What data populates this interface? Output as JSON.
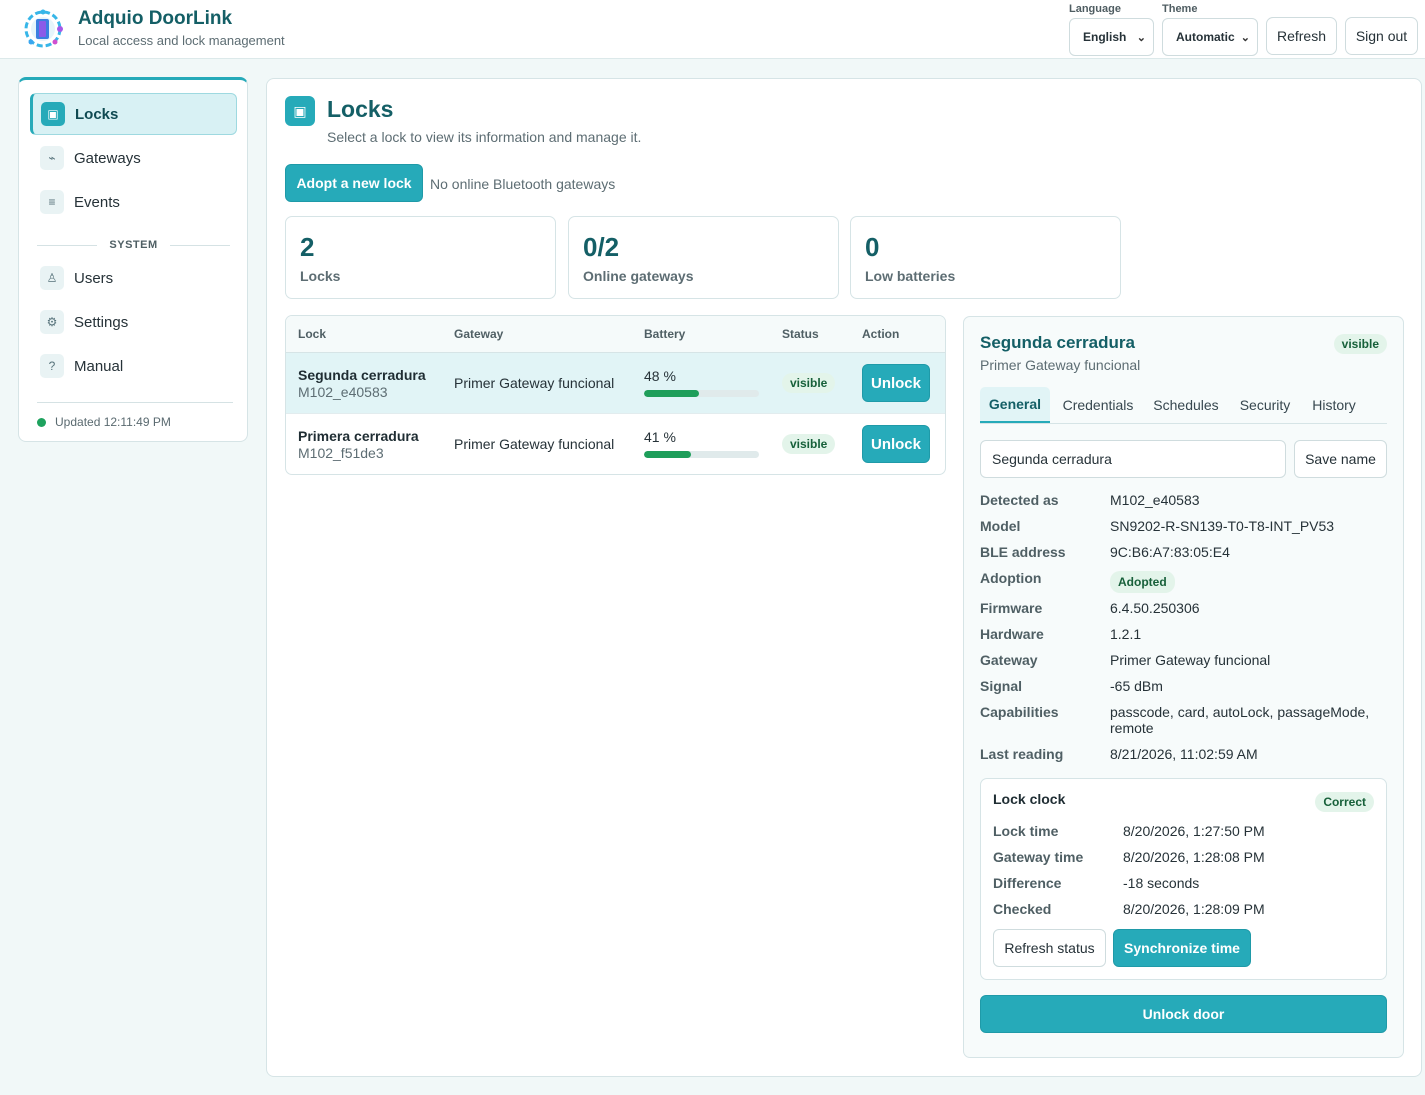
{
  "header": {
    "title": "Adquio DoorLink",
    "subtitle": "Local access and lock management",
    "language_label": "Language",
    "language_value": "English",
    "theme_label": "Theme",
    "theme_value": "Automatic",
    "refresh_label": "Refresh",
    "signout_label": "Sign out"
  },
  "sidebar": {
    "items": [
      {
        "label": "Locks",
        "icon": "lock-icon",
        "glyph": "▣",
        "active": true
      },
      {
        "label": "Gateways",
        "icon": "gateway-icon",
        "glyph": "⌁"
      },
      {
        "label": "Events",
        "icon": "events-icon",
        "glyph": "≡"
      },
      {
        "label": "Users",
        "icon": "users-icon",
        "glyph": "♙"
      },
      {
        "label": "Settings",
        "icon": "gear-icon",
        "glyph": "⚙"
      },
      {
        "label": "Manual",
        "icon": "help-icon",
        "glyph": "?"
      }
    ],
    "system_label": "SYSTEM",
    "updated_text": "Updated 12:11:49 PM"
  },
  "main": {
    "icon_glyph": "▣",
    "title": "Locks",
    "subtitle": "Select a lock to view its information and manage it.",
    "adopt_label": "Adopt a new lock",
    "no_gateways_text": "No online Bluetooth gateways",
    "stats": [
      {
        "value": "2",
        "label": "Locks"
      },
      {
        "value": "0/2",
        "label": "Online gateways"
      },
      {
        "value": "0",
        "label": "Low batteries"
      }
    ]
  },
  "table": {
    "columns": [
      "Lock",
      "Gateway",
      "Battery",
      "Status",
      "Action"
    ],
    "rows": [
      {
        "name": "Segunda cerradura",
        "id": "M102_e40583",
        "gateway": "Primer Gateway funcional",
        "battery": "48 %",
        "battery_pct": 48,
        "status": "visible",
        "action": "Unlock",
        "selected": true
      },
      {
        "name": "Primera cerradura",
        "id": "M102_f51de3",
        "gateway": "Primer Gateway funcional",
        "battery": "41 %",
        "battery_pct": 41,
        "status": "visible",
        "action": "Unlock",
        "selected": false
      }
    ]
  },
  "detail": {
    "title": "Segunda cerradura",
    "subtitle": "Primer Gateway funcional",
    "badge": "visible",
    "tabs": [
      "General",
      "Credentials",
      "Schedules",
      "Security",
      "History"
    ],
    "name_value": "Segunda cerradura",
    "save_name_label": "Save name",
    "info": [
      {
        "key": "Detected as",
        "value": "M102_e40583"
      },
      {
        "key": "Model",
        "value": "SN9202-R-SN139-T0-T8-INT_PV53"
      },
      {
        "key": "BLE address",
        "value": "9C:B6:A7:83:05:E4"
      },
      {
        "key": "Adoption",
        "value": "Adopted"
      },
      {
        "key": "Firmware",
        "value": "6.4.50.250306"
      },
      {
        "key": "Hardware",
        "value": "1.2.1"
      },
      {
        "key": "Gateway",
        "value": "Primer Gateway funcional"
      },
      {
        "key": "Signal",
        "value": "-65 dBm"
      },
      {
        "key": "Capabilities",
        "value": "passcode, card, autoLock, passageMode, remote"
      },
      {
        "key": "Last reading",
        "value": "8/21/2026, 11:02:59 AM"
      }
    ],
    "clock": {
      "title": "Lock clock",
      "badge": "Correct",
      "rows": [
        {
          "key": "Lock time",
          "value": "8/20/2026, 1:27:50 PM"
        },
        {
          "key": "Gateway time",
          "value": "8/20/2026, 1:28:08 PM"
        },
        {
          "key": "Difference",
          "value": "-18 seconds"
        },
        {
          "key": "Checked",
          "value": "8/20/2026, 1:28:09 PM"
        }
      ],
      "refresh_label": "Refresh status",
      "sync_label": "Synchronize time"
    },
    "unlock_door_label": "Unlock door"
  },
  "colors": {
    "accent": "#26aab9",
    "title": "#145f66",
    "battery": "#1e9e5a",
    "online_dot": "#1ea25e"
  }
}
